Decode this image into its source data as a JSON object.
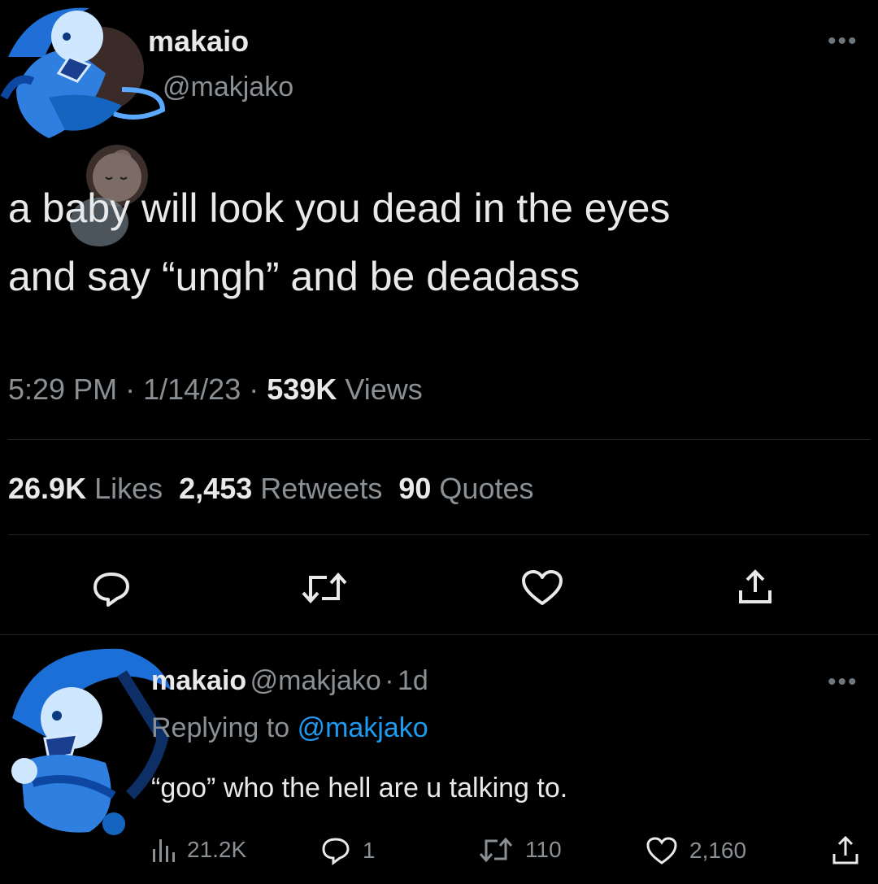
{
  "tweet": {
    "display_name": "makaio",
    "handle": "@makjako",
    "more_icon": "more-horizontal-icon",
    "text_line1": "a baby will look you dead in the eyes",
    "text_line2": "and say “ungh” and be deadass",
    "time": "5:29 PM",
    "sep1": "·",
    "date": "1/14/23",
    "sep2": "·",
    "views_count": "539K",
    "views_label": "Views",
    "likes_count": "26.9K",
    "likes_label": "Likes",
    "retweets_count": "2,453",
    "retweets_label": "Retweets",
    "quotes_count": "90",
    "quotes_label": "Quotes",
    "actions": [
      "reply-icon",
      "retweet-icon",
      "like-icon",
      "share-icon"
    ]
  },
  "reply": {
    "display_name": "makaio",
    "handle": "@makjako",
    "sep": "·",
    "age": "1d",
    "replying_prefix": "Replying to",
    "replying_handle": "@makjako",
    "text": "“goo” who the hell are u talking to.",
    "views": "21.2K",
    "replies": "1",
    "retweets": "110",
    "likes": "2,160"
  },
  "colors": {
    "background": "#000000",
    "text": "#e7e9ea",
    "muted": "#8b9095",
    "link": "#1d9bf0",
    "avatar_blue": "#2f7fe0"
  }
}
